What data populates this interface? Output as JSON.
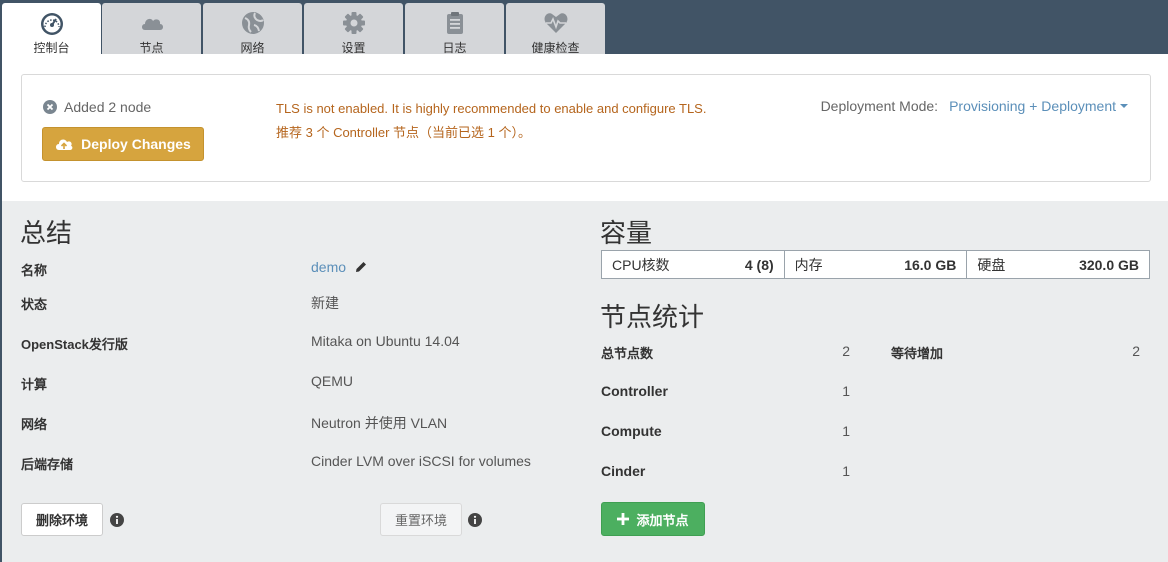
{
  "nav": {
    "tabs": [
      {
        "label": "控制台",
        "icon": "dashboard-gauge-icon",
        "active": true
      },
      {
        "label": "节点",
        "icon": "cloud-icon",
        "active": false
      },
      {
        "label": "网络",
        "icon": "globe-icon",
        "active": false
      },
      {
        "label": "设置",
        "icon": "gear-icon",
        "active": false
      },
      {
        "label": "日志",
        "icon": "clipboard-icon",
        "active": false
      },
      {
        "label": "健康检查",
        "icon": "heart-pulse-icon",
        "active": false
      }
    ]
  },
  "deploy_panel": {
    "added_text": "Added 2 node",
    "deploy_button": "Deploy Changes",
    "warning_line1": "TLS is not enabled. It is highly recommended to enable and configure TLS.",
    "warning_line2": "推荐 3 个 Controller 节点（当前已选 1 个）。",
    "mode_label": "Deployment Mode:",
    "mode_value": "Provisioning + Deployment"
  },
  "summary": {
    "title": "总结",
    "rows": [
      {
        "label": "名称",
        "value": "demo"
      },
      {
        "label": "状态",
        "value": "新建"
      },
      {
        "label": "OpenStack发行版",
        "value": "Mitaka on Ubuntu 14.04"
      },
      {
        "label": "计算",
        "value": "QEMU"
      },
      {
        "label": "网络",
        "value": "Neutron 并使用 VLAN"
      },
      {
        "label": "后端存储",
        "value": "Cinder LVM over iSCSI for volumes"
      }
    ],
    "delete_button": "删除环境",
    "reset_button": "重置环境"
  },
  "capacity": {
    "title": "容量",
    "cells": [
      {
        "label": "CPU核数",
        "value": "4 (8)"
      },
      {
        "label": "内存",
        "value": "16.0 GB"
      },
      {
        "label": "硬盘",
        "value": "320.0 GB"
      }
    ]
  },
  "node_stats": {
    "title": "节点统计",
    "rows": [
      {
        "label": "总节点数",
        "value": "2"
      },
      {
        "label": "Controller",
        "value": "1"
      },
      {
        "label": "Compute",
        "value": "1"
      },
      {
        "label": "Cinder",
        "value": "1"
      }
    ],
    "pending_label": "等待增加",
    "pending_value": "2",
    "add_button": "添加节点"
  },
  "colors": {
    "topbar": "#415466",
    "deploy_button": "#d6a43e",
    "warning_text": "#b5651d",
    "link": "#5b8fb9",
    "add_button": "#4caf60",
    "content_bg": "#ebedee"
  }
}
